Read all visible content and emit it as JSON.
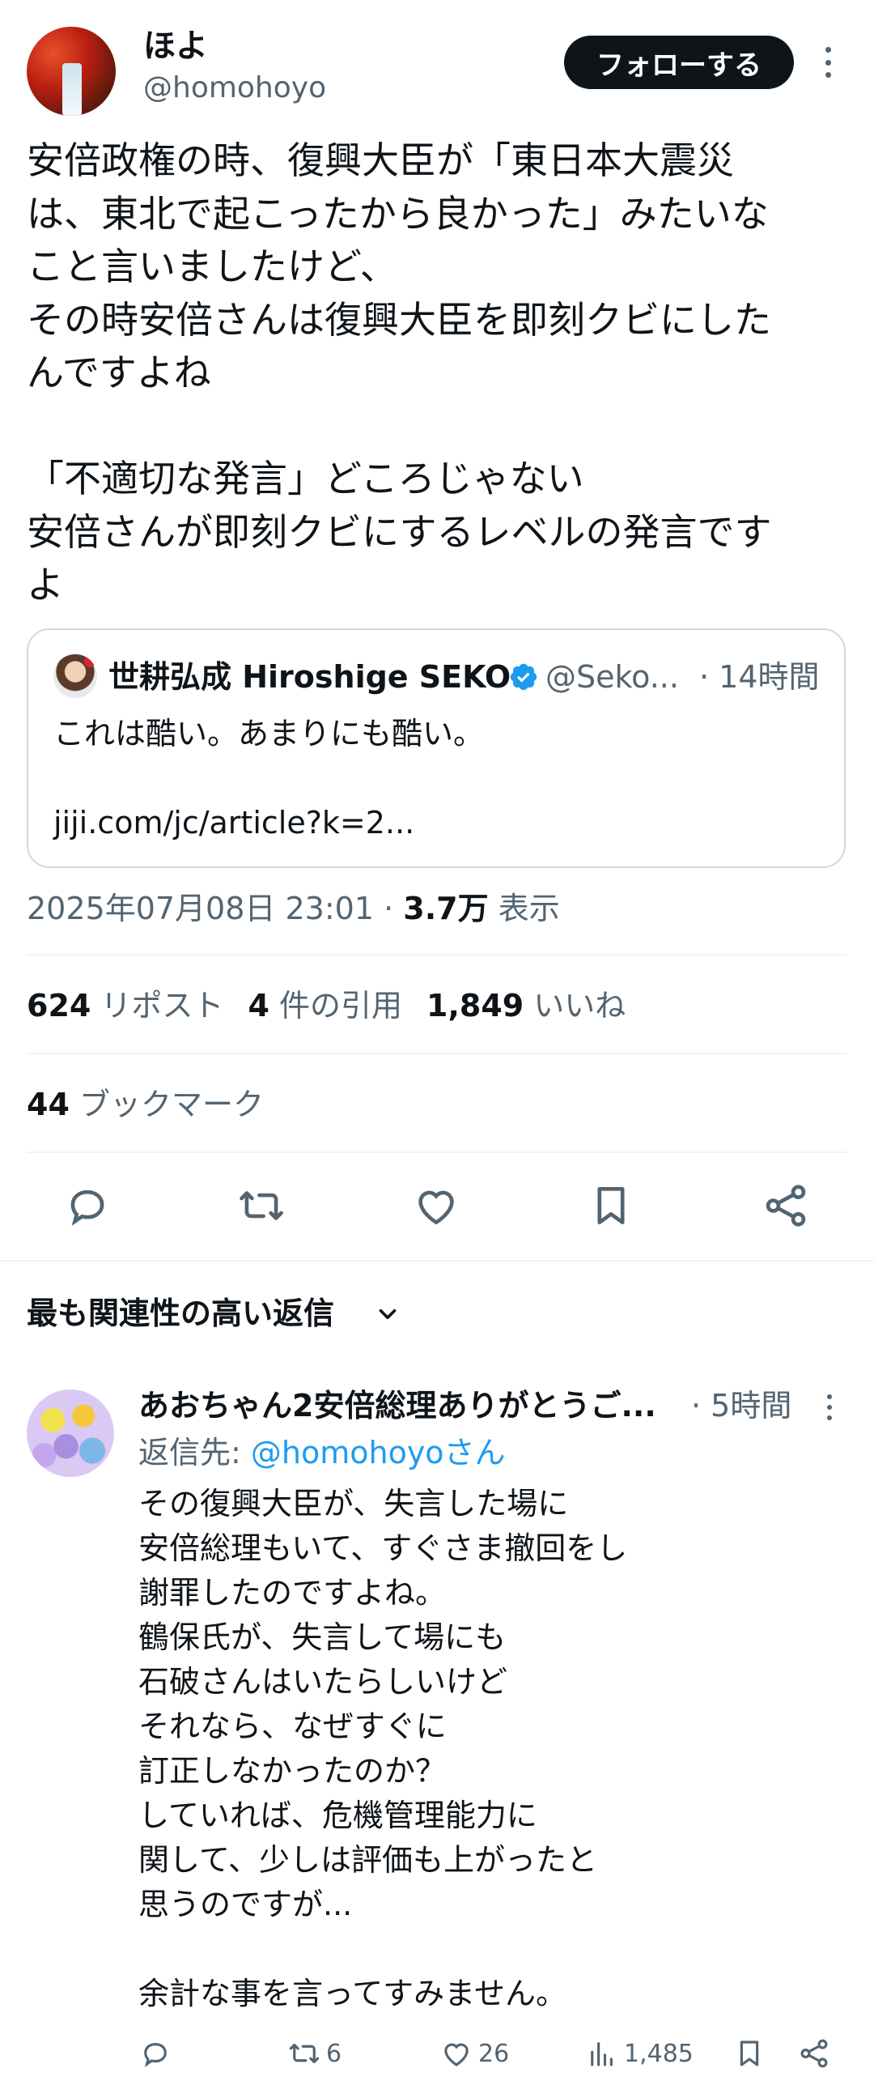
{
  "tweet": {
    "author_name": "ほよ",
    "author_handle": "@homohoyo",
    "follow_label": "フォローする",
    "text": "安倍政権の時、復興大臣が「東日本大震災\nは、東北で起こったから良かった」みたいな\nこと言いましたけど、\nその時安倍さんは復興大臣を即刻クビにした\nんですよね\n\n「不適切な発言」どころじゃない\n安倍さんが即刻クビにするレベルの発言です\nよ",
    "quote": {
      "name": "世耕弘成 Hiroshige SEKO",
      "handle": "@Seko...",
      "time": "· 14時間",
      "text": "これは酷い。あまりにも酷い。",
      "link": "jiji.com/jc/article?k=2..."
    },
    "timestamp": "2025年07月08日 23:01",
    "separator": "·",
    "views_count": "3.7万",
    "views_label": "表示",
    "reposts_count": "624",
    "reposts_label": "リポスト",
    "quotes_count": "4",
    "quotes_label": "件の引用",
    "likes_count": "1,849",
    "likes_label": "いいね",
    "bookmarks_count": "44",
    "bookmarks_label": "ブックマーク"
  },
  "replies_sort_label": "最も関連性の高い返信",
  "reply": {
    "name": "あおちゃん2安倍総理ありがとうご...",
    "time": "· 5時間",
    "reply_to_prefix": "返信先: ",
    "reply_to_handle": "@homohoyoさん",
    "text": "その復興大臣が、失言した場に\n安倍総理もいて、すぐさま撤回をし\n謝罪したのですよね。\n鶴保氏が、失言して場にも\n石破さんはいたらしいけど\nそれなら、なぜすぐに\n訂正しなかったのか？\nしていれば、危機管理能力に\n関して、少しは評価も上がったと\n思うのですが...\n\n余計な事を言ってすみません。",
    "reposts": "6",
    "likes": "26",
    "views": "1,485"
  },
  "colors": {
    "text": "#0f1419",
    "secondary": "#536471",
    "accent": "#1d9bf0",
    "divider": "#eff3f4"
  }
}
